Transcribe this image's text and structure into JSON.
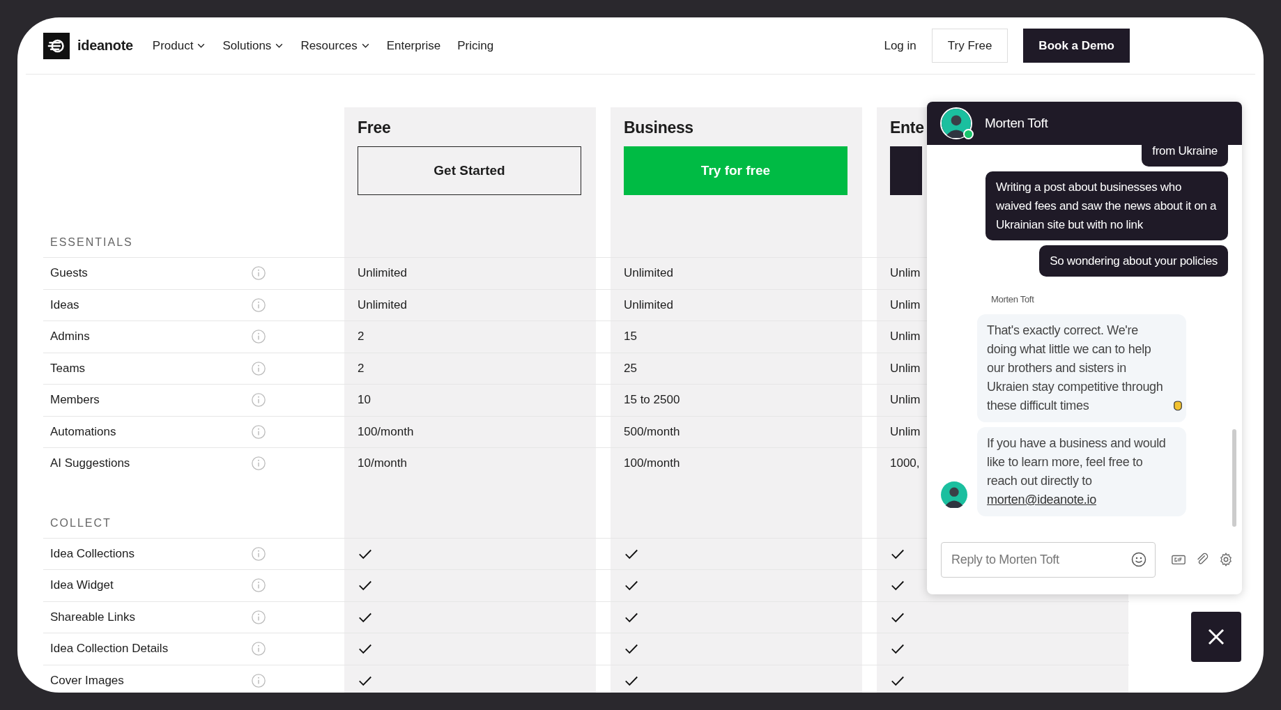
{
  "nav": {
    "logo": "ideanote",
    "menu": [
      {
        "label": "Product",
        "dropdown": true
      },
      {
        "label": "Solutions",
        "dropdown": true
      },
      {
        "label": "Resources",
        "dropdown": true
      },
      {
        "label": "Enterprise",
        "dropdown": false
      },
      {
        "label": "Pricing",
        "dropdown": false
      }
    ],
    "login": "Log in",
    "try": "Try Free",
    "demo": "Book a Demo"
  },
  "plans": [
    {
      "name": "Free",
      "button": "Get Started",
      "kind": "outline"
    },
    {
      "name": "Business",
      "button": "Try for free",
      "kind": "green"
    },
    {
      "name": "Ente",
      "kind": "dark"
    }
  ],
  "sections": [
    {
      "title": "ESSENTIALS",
      "rows": [
        {
          "label": "Guests",
          "cells": [
            {
              "kind": "text",
              "text": "Unlimited"
            },
            {
              "kind": "text",
              "text": "Unlimited"
            },
            {
              "kind": "text",
              "text": "Unlim"
            }
          ]
        },
        {
          "label": "Ideas",
          "cells": [
            {
              "kind": "text",
              "text": "Unlimited"
            },
            {
              "kind": "text",
              "text": "Unlimited"
            },
            {
              "kind": "text",
              "text": "Unlim"
            }
          ]
        },
        {
          "label": "Admins",
          "cells": [
            {
              "kind": "text",
              "text": "2"
            },
            {
              "kind": "text",
              "text": "15"
            },
            {
              "kind": "text",
              "text": "Unlim"
            }
          ]
        },
        {
          "label": "Teams",
          "cells": [
            {
              "kind": "text",
              "text": "2"
            },
            {
              "kind": "text",
              "text": "25"
            },
            {
              "kind": "text",
              "text": "Unlim"
            }
          ]
        },
        {
          "label": "Members",
          "cells": [
            {
              "kind": "text",
              "text": "10"
            },
            {
              "kind": "text",
              "text": "15 to 2500"
            },
            {
              "kind": "text",
              "text": "Unlim"
            }
          ]
        },
        {
          "label": "Automations",
          "cells": [
            {
              "kind": "text",
              "text": "100/month"
            },
            {
              "kind": "text",
              "text": "500/month"
            },
            {
              "kind": "text",
              "text": "Unlim"
            }
          ]
        },
        {
          "label": "AI Suggestions",
          "cells": [
            {
              "kind": "text",
              "text": "10/month"
            },
            {
              "kind": "text",
              "text": "100/month"
            },
            {
              "kind": "text",
              "text": "1000,"
            }
          ]
        }
      ]
    },
    {
      "title": "COLLECT",
      "rows": [
        {
          "label": "Idea Collections",
          "cells": [
            {
              "kind": "check"
            },
            {
              "kind": "check"
            },
            {
              "kind": "check"
            }
          ]
        },
        {
          "label": "Idea Widget",
          "cells": [
            {
              "kind": "check"
            },
            {
              "kind": "check"
            },
            {
              "kind": "check"
            }
          ]
        },
        {
          "label": "Shareable Links",
          "cells": [
            {
              "kind": "check"
            },
            {
              "kind": "check"
            },
            {
              "kind": "check"
            }
          ]
        },
        {
          "label": "Idea Collection Details",
          "cells": [
            {
              "kind": "check"
            },
            {
              "kind": "check"
            },
            {
              "kind": "check"
            }
          ]
        },
        {
          "label": "Cover Images",
          "cells": [
            {
              "kind": "check"
            },
            {
              "kind": "check"
            },
            {
              "kind": "check"
            }
          ]
        }
      ]
    }
  ],
  "chat": {
    "name": "Morten Toft",
    "online": true,
    "messages": [
      {
        "kind": "sent",
        "text": "from Ukraine"
      },
      {
        "kind": "sent",
        "text": "Writing a post about businesses who waived fees and saw the news about it on a Ukrainian site but with no link"
      },
      {
        "kind": "sent",
        "text": "So wondering about your policies"
      },
      {
        "kind": "sender",
        "text": "Morten Toft"
      },
      {
        "kind": "received",
        "text": "That's exactly correct. We're doing what little we can to help our brothers and sisters in Ukraien stay competitive through these difficult times",
        "emoji": true
      },
      {
        "kind": "received",
        "text": "If you have a business and would like to learn more, feel free to reach out directly to",
        "link": "morten@ideanote.io",
        "avatar": true
      }
    ],
    "placeholder": "Reply to Morten Toft"
  }
}
